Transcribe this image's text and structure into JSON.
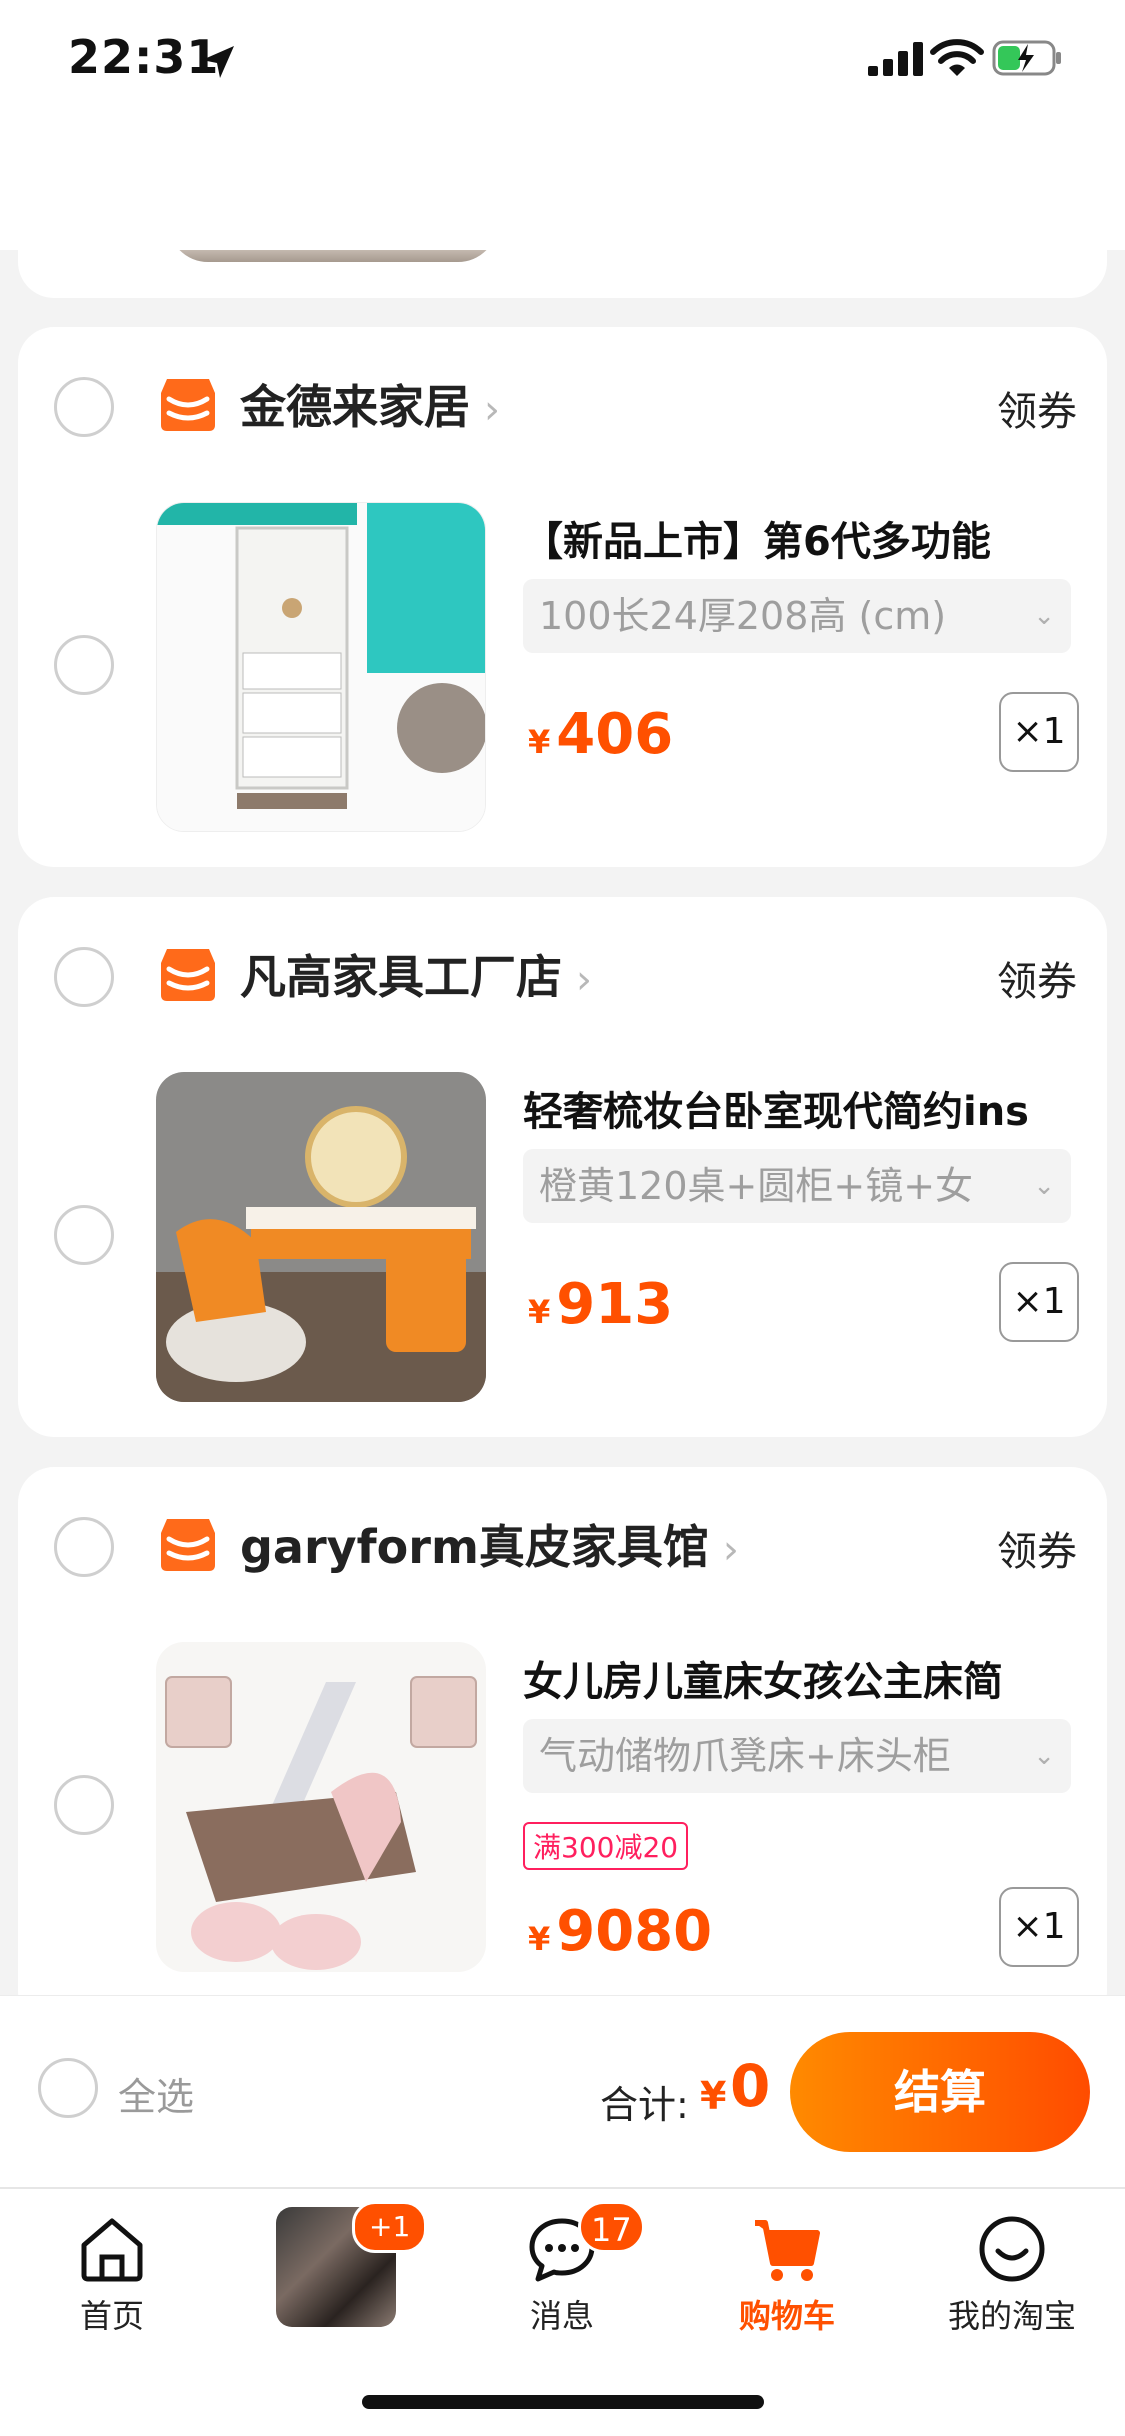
{
  "status_bar": {
    "time": "22:31"
  },
  "shops": [
    {
      "name": "金德来家居",
      "coupon_label": "领券",
      "item": {
        "title": "【新品上市】第6代多功能",
        "sku": "100长24厚208高 (cm)",
        "currency": "¥",
        "price": "406",
        "quantity": "×1"
      }
    },
    {
      "name": "凡高家具工厂店",
      "coupon_label": "领券",
      "item": {
        "title": "轻奢梳妆台卧室现代简约ins",
        "sku": "橙黄120桌+圆柜+镜+女",
        "currency": "¥",
        "price": "913",
        "quantity": "×1"
      }
    },
    {
      "name": "garyform真皮家具馆",
      "coupon_label": "领券",
      "item": {
        "title": "女儿房儿童床女孩公主床简",
        "sku": "气动储物爪凳床+床头柜",
        "promo": "满300减20",
        "currency": "¥",
        "price": "9080",
        "quantity": "×1"
      }
    }
  ],
  "checkout": {
    "select_all": "全选",
    "total_label": "合计:",
    "currency": "¥",
    "total": "0",
    "button": "结算"
  },
  "tabbar": {
    "home": "首页",
    "live_badge": "+1",
    "messages": "消息",
    "messages_badge": "17",
    "cart": "购物车",
    "me": "我的淘宝"
  },
  "colors": {
    "accent": "#ff5000",
    "promo": "#ff1f5e"
  }
}
